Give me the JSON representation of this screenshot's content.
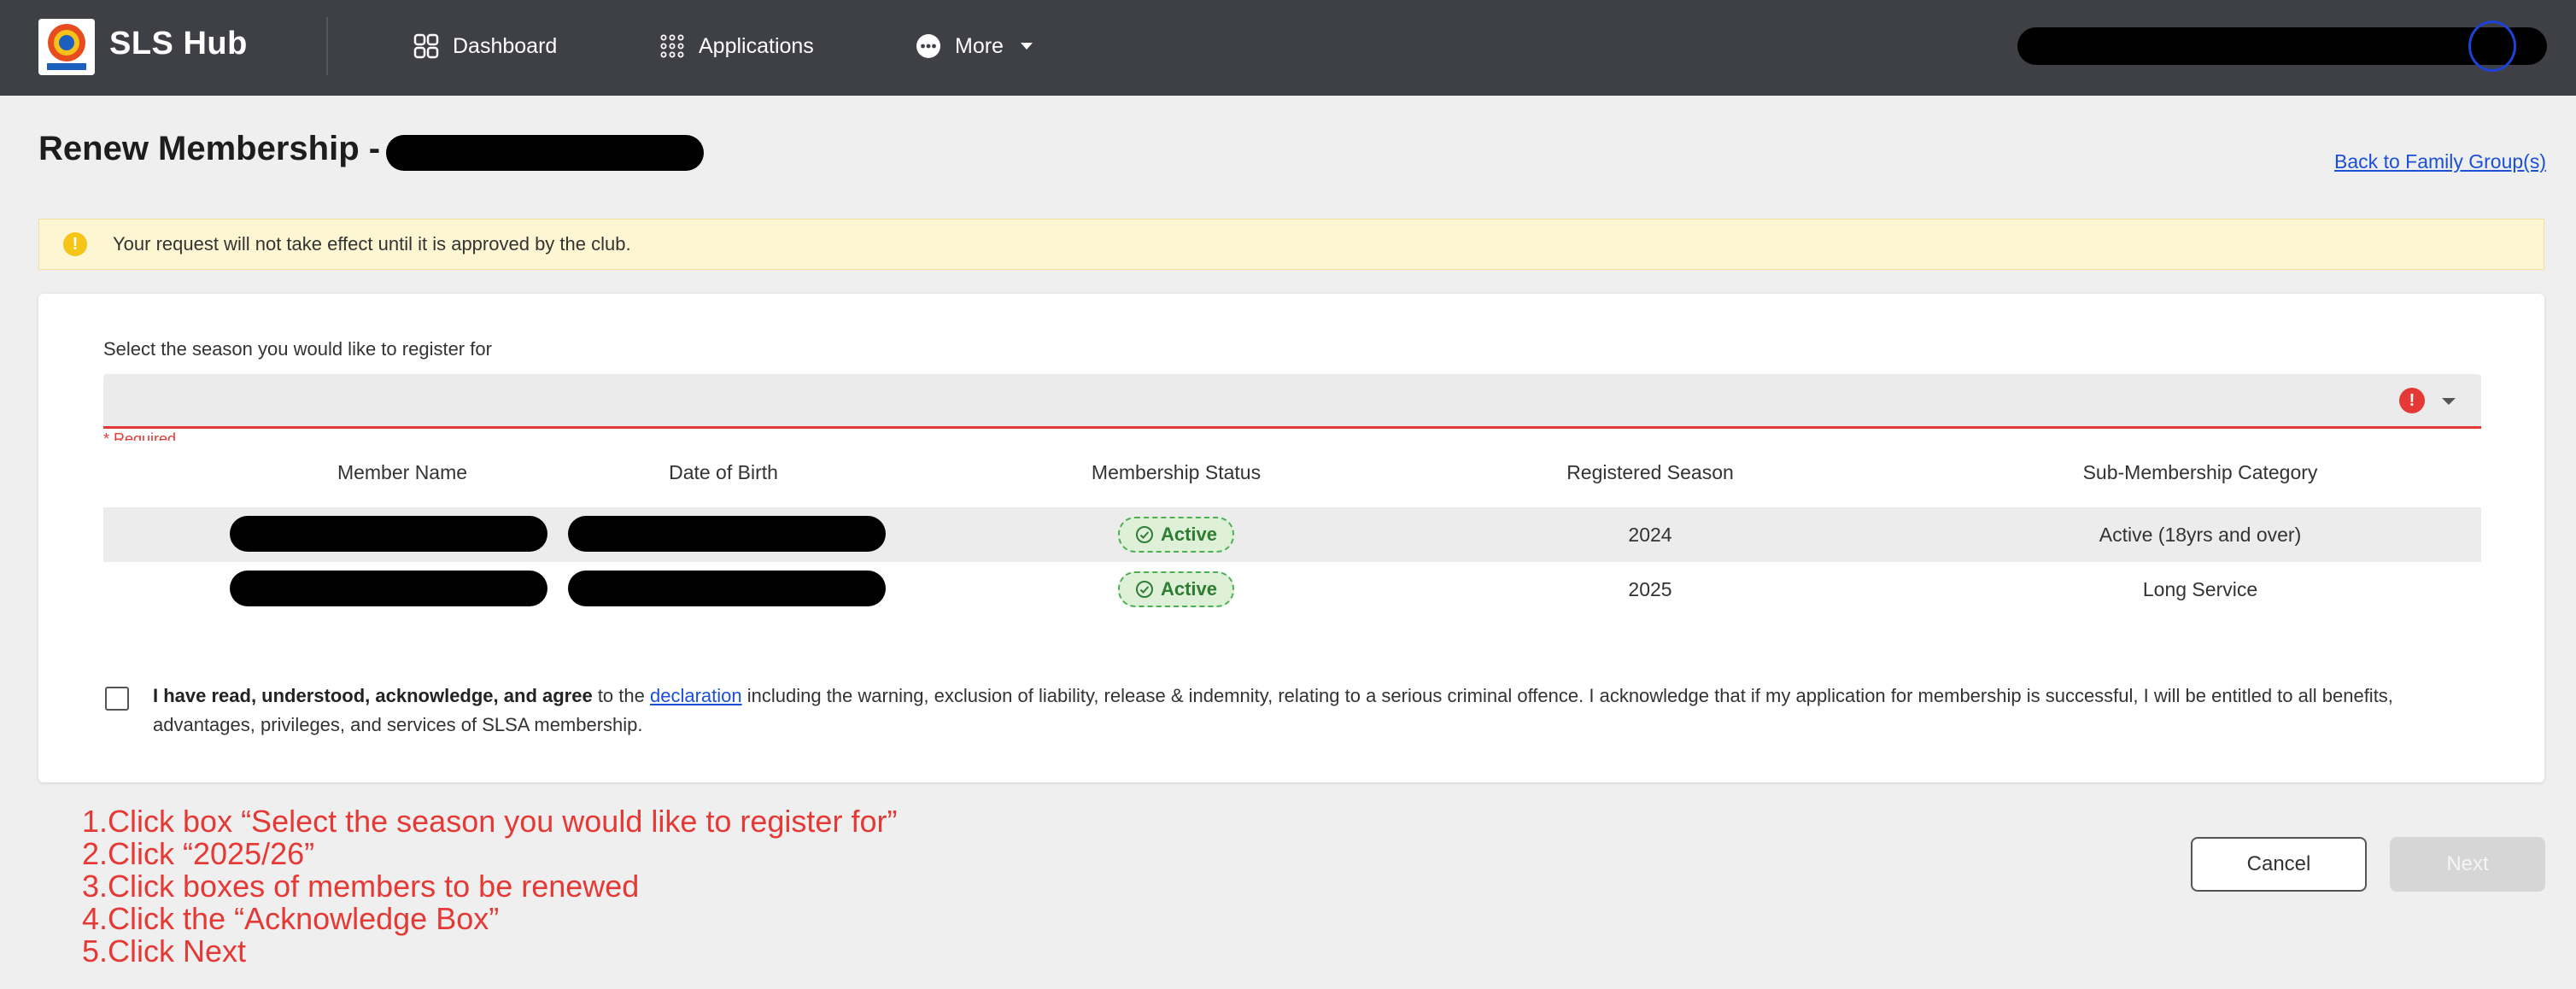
{
  "app": {
    "brand": "SLS Hub",
    "nav": {
      "dashboard": "Dashboard",
      "applications": "Applications",
      "more": "More"
    }
  },
  "page": {
    "title": "Renew Membership -",
    "back_link": "Back to Family Group(s)"
  },
  "alert": {
    "icon": "warning-icon",
    "text": "Your request will not take effect until it is approved by the club."
  },
  "season": {
    "label": "Select the season you would like to register for",
    "value": "",
    "required": "* Required"
  },
  "table": {
    "headers": [
      "Member Name",
      "Date of Birth",
      "Membership Status",
      "Registered Season",
      "Sub-Membership Category"
    ],
    "rows": [
      {
        "status": "Active",
        "season": "2024",
        "category": "Active (18yrs and over)"
      },
      {
        "status": "Active",
        "season": "2025",
        "category": "Long Service"
      }
    ]
  },
  "declaration": {
    "bold": "I have read, understood, acknowledge, and agree",
    "pre_link": " to the ",
    "link": "declaration",
    "rest": " including the warning, exclusion of liability, release & indemnity, relating to a serious criminal offence. I acknowledge that if my application for membership is successful, I will be entitled to all benefits, advantages, privileges, and services of SLSA membership."
  },
  "instructions": [
    "1.Click box “Select the season you would like to register for”",
    "2.Click “2025/26”",
    "3.Click boxes of members to be renewed",
    "4.Click the “Acknowledge Box”",
    "5.Click Next"
  ],
  "buttons": {
    "cancel": "Cancel",
    "next": "Next"
  },
  "colors": {
    "topbar": "#3f3f46",
    "link": "#1a4fd6",
    "error": "#e53935",
    "alert_bg": "#fdf6d3",
    "badge_green": "#2e7d32"
  }
}
